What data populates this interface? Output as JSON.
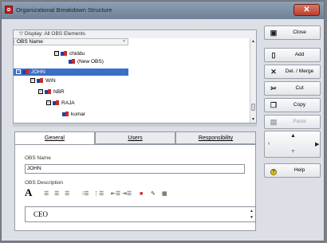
{
  "window": {
    "title": "Organizational Breakdown Structure"
  },
  "tree": {
    "filter_label": "Display: All OBS Elements",
    "column_header": "OBS Name",
    "rows": [
      {
        "label": "chiddu",
        "expander": "−",
        "selected": false
      },
      {
        "label": "(New OBS)",
        "expander": "",
        "selected": false
      },
      {
        "label": "JOHN",
        "expander": "−",
        "selected": true
      },
      {
        "label": "WIN",
        "expander": "−",
        "selected": false
      },
      {
        "label": "NBR",
        "expander": "−",
        "selected": false
      },
      {
        "label": "RAJA",
        "expander": "−",
        "selected": false
      },
      {
        "label": "kumar",
        "expander": "",
        "selected": false
      }
    ]
  },
  "tabs": [
    {
      "label": "General",
      "active": true
    },
    {
      "label": "Users",
      "active": false
    },
    {
      "label": "Responsibility",
      "active": false
    }
  ],
  "general": {
    "obs_name_label": "OBS Name",
    "obs_name_value": "JOHN",
    "obs_description_label": "OBS Description",
    "description_text": "CEO"
  },
  "toolbar": {
    "font_glyph": "A"
  },
  "buttons": {
    "close": "Close",
    "add": "Add",
    "del_merge": "Del. / Merge",
    "cut": "Cut",
    "copy": "Copy",
    "paste": "Paste",
    "help": "Help"
  },
  "colors": {
    "selection": "#3a6fc6",
    "title_bar": "#7f92a8",
    "close_button": "#c24a37"
  }
}
